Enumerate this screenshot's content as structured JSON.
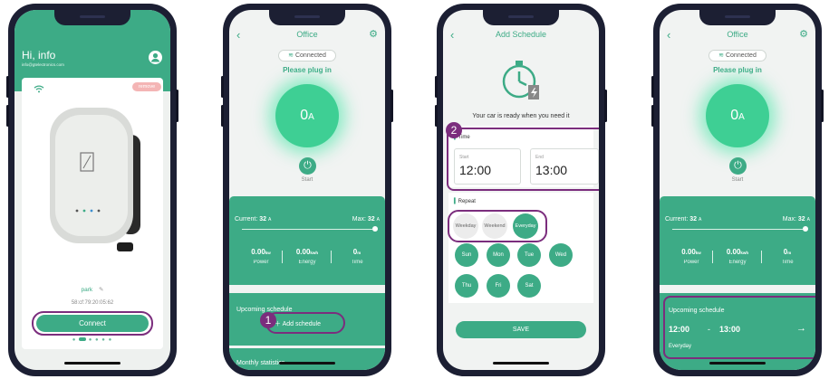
{
  "phone1": {
    "greeting": "Hi,  info",
    "email": "info@gtelectronics.com",
    "remove_label": "remove",
    "device_name": "park",
    "mac": "58:cf:79:20:05:62",
    "connect_label": "Connect"
  },
  "phone2": {
    "title": "Office",
    "status": "Connected",
    "plug_prompt": "Please plug in",
    "current_value": "0",
    "current_unit": "A",
    "start_label": "Start",
    "current_label": "Current:",
    "current_setting": "32",
    "current_setting_unit": "A",
    "max_label": "Max:",
    "max_value": "32",
    "max_unit": "A",
    "power_value": "0.00",
    "power_unit": "kw",
    "power_label": "Power",
    "energy_value": "0.00",
    "energy_unit": "kwh",
    "energy_label": "Energy",
    "time_value": "0",
    "time_unit": "m",
    "time_label": "Time",
    "upcoming_title": "Upcoming schedule",
    "add_schedule_label": "Add schedule",
    "monthly_title": "Monthly statistics",
    "step_number": "1"
  },
  "phone3": {
    "title": "Add Schedule",
    "ready_text": "Your car is ready when you need it",
    "time_section": "Time",
    "start_label": "Start",
    "start_time": "12:00",
    "end_label": "End",
    "end_time": "13:00",
    "repeat_section": "Repeat",
    "repeat_options": [
      "Weekday",
      "Weekend",
      "Everyday"
    ],
    "days_row1": [
      "Sun",
      "Mon",
      "Tue",
      "Wed"
    ],
    "days_row2": [
      "Thu",
      "Fri",
      "Sat"
    ],
    "save_label": "SAVE",
    "step_number": "2"
  },
  "phone4": {
    "title": "Office",
    "status": "Connected",
    "plug_prompt": "Please plug in",
    "current_value": "0",
    "current_unit": "A",
    "start_label": "Start",
    "current_label": "Current:",
    "current_setting": "32",
    "current_setting_unit": "A",
    "max_label": "Max:",
    "max_value": "32",
    "max_unit": "A",
    "power_value": "0.00",
    "power_unit": "kw",
    "power_label": "Power",
    "energy_value": "0.00",
    "energy_unit": "kwh",
    "energy_label": "Energy",
    "time_value": "0",
    "time_unit": "m",
    "time_label": "Time",
    "upcoming_title": "Upcoming schedule",
    "schedule_start": "12:00",
    "schedule_dash": "-",
    "schedule_end": "13:00",
    "schedule_repeat": "Everyday"
  },
  "icons": {
    "user": "user-icon",
    "wifi": "wifi-icon",
    "back": "chevron-left-icon",
    "gear": "gear-icon",
    "power": "power-icon",
    "timer": "stopwatch-icon",
    "arrow": "arrow-right-icon",
    "edit": "edit-icon"
  },
  "colors": {
    "accent": "#3dab86",
    "highlight": "#7b2d7d",
    "frame": "#1c1f33",
    "glow": "#3ecf94"
  }
}
